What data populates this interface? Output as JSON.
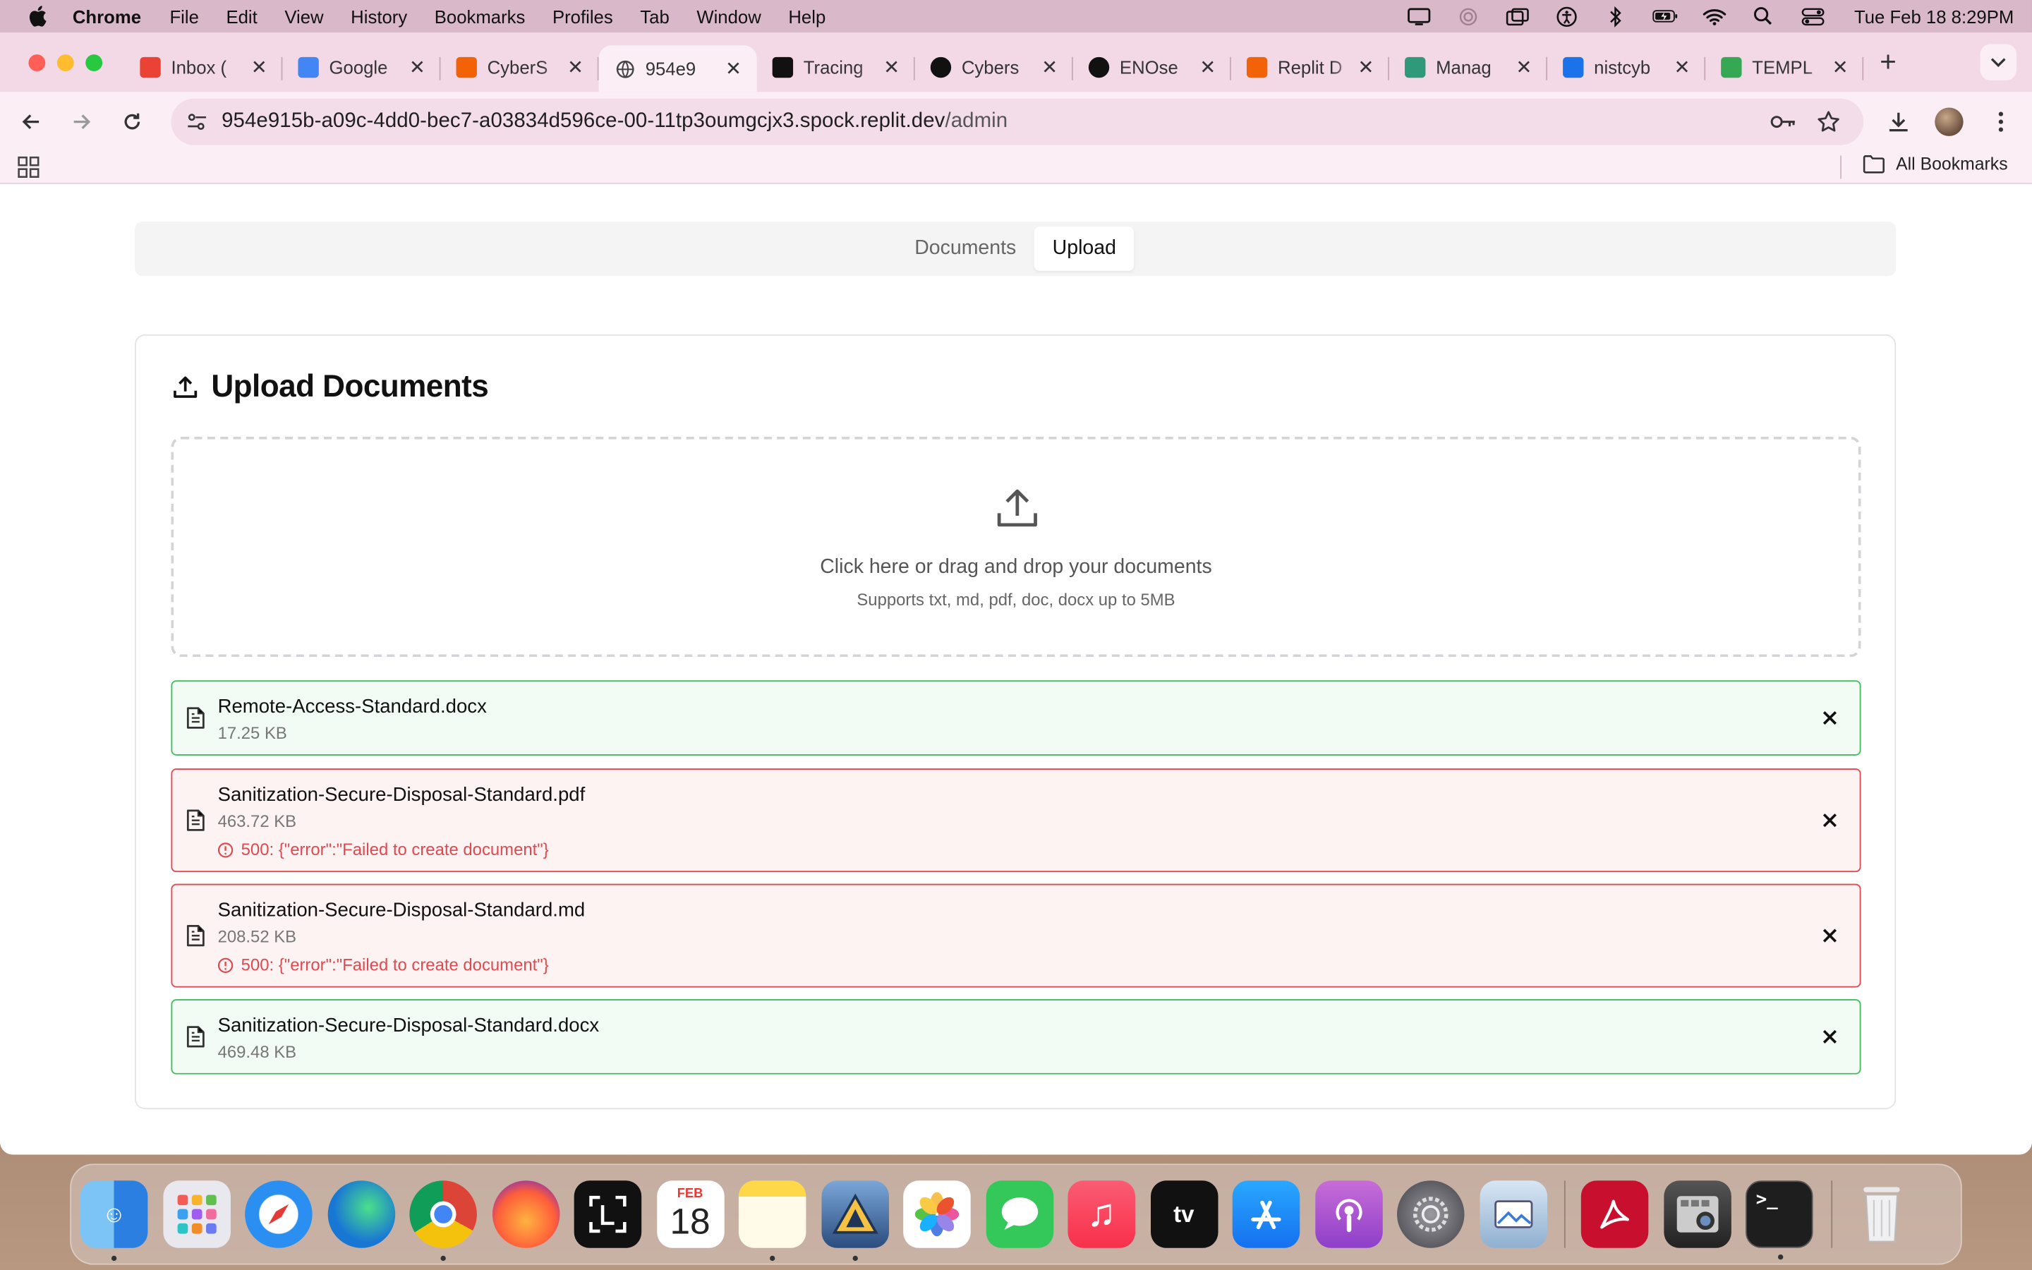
{
  "menubar": {
    "app_name": "Chrome",
    "items": [
      "File",
      "Edit",
      "View",
      "History",
      "Bookmarks",
      "Profiles",
      "Tab",
      "Window",
      "Help"
    ],
    "clock": "Tue Feb 18  8:29PM"
  },
  "tabs": [
    {
      "label": "Inbox (",
      "favicon": "gmail-icon",
      "color": "#ea4335",
      "active": false
    },
    {
      "label": "Google",
      "favicon": "google-calendar-icon",
      "color": "#4285f4",
      "active": false
    },
    {
      "label": "CyberS",
      "favicon": "replit-icon",
      "color": "#f26207",
      "active": false
    },
    {
      "label": "954e9",
      "favicon": "globe-icon",
      "color": "#555555",
      "active": true
    },
    {
      "label": "Tracing",
      "favicon": "tracing-icon",
      "color": "#111111",
      "active": false
    },
    {
      "label": "Cybers",
      "favicon": "openai-icon",
      "color": "#111111",
      "active": false
    },
    {
      "label": "ENOse",
      "favicon": "enosec-icon",
      "color": "#111111",
      "active": false
    },
    {
      "label": "Replit D",
      "favicon": "replit-icon",
      "color": "#f26207",
      "active": false
    },
    {
      "label": "Manag",
      "favicon": "hubstaff-icon",
      "color": "#2f9a7a",
      "active": false
    },
    {
      "label": "nistcyb",
      "favicon": "sheets-chart-icon",
      "color": "#1a73e8",
      "active": false
    },
    {
      "label": "TEMPL",
      "favicon": "google-drive-icon",
      "color": "#34a853",
      "active": false
    }
  ],
  "toolbar": {
    "url_host": "954e915b-a09c-4dd0-bec7-a03834d596ce-00-11tp3oumgcjx3.spock.replit.dev",
    "url_path": "/admin"
  },
  "bookmarks_bar": {
    "all_bookmarks": "All Bookmarks"
  },
  "page": {
    "tabs": [
      {
        "label": "Documents",
        "active": false
      },
      {
        "label": "Upload",
        "active": true
      }
    ],
    "card_title": "Upload Documents",
    "dropzone": {
      "primary": "Click here or drag and drop your documents",
      "secondary": "Supports txt, md, pdf, doc, docx up to 5MB"
    },
    "files": [
      {
        "name": "Remote-Access-Standard.docx",
        "size": "17.25 KB",
        "status": "success",
        "error": ""
      },
      {
        "name": "Sanitization-Secure-Disposal-Standard.pdf",
        "size": "463.72 KB",
        "status": "error",
        "error": "500: {\"error\":\"Failed to create document\"}"
      },
      {
        "name": "Sanitization-Secure-Disposal-Standard.md",
        "size": "208.52 KB",
        "status": "error",
        "error": "500: {\"error\":\"Failed to create document\"}"
      },
      {
        "name": "Sanitization-Secure-Disposal-Standard.docx",
        "size": "469.48 KB",
        "status": "success",
        "error": ""
      }
    ]
  },
  "colors": {
    "success_border": "#3fbf5c",
    "error_border": "#e0494f",
    "error_text": "#e0494f",
    "tabstrip": "#f3d9e6",
    "toolbar": "#fbeef5"
  },
  "dock": {
    "apps": [
      "finder-icon",
      "launchpad-icon",
      "safari-icon",
      "edge-icon",
      "chrome-icon",
      "firefox-icon",
      "lens-icon",
      "calendar-icon",
      "notes-icon",
      "pasta-icon",
      "photos-icon",
      "messages-icon",
      "music-icon",
      "apple-tv-icon",
      "app-store-icon",
      "podcasts-icon",
      "system-settings-icon",
      "preview-icon",
      "acrobat-icon",
      "image-capture-icon",
      "terminal-icon",
      "trash-icon"
    ],
    "calendar_month": "FEB",
    "calendar_day": "18",
    "tv_label": "tv"
  }
}
